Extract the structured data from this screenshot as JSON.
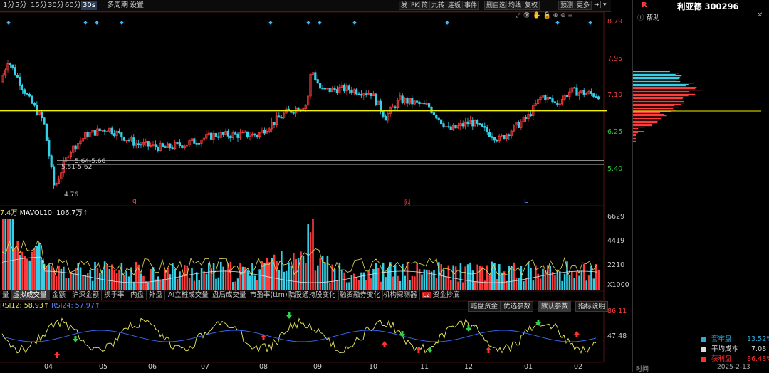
{
  "toolbar": {
    "periods": [
      "1分",
      "5分",
      "15分",
      "30分",
      "60分",
      "30s",
      "多周期",
      "设置"
    ],
    "right_items": [
      "发",
      "PK",
      "简",
      "九转",
      "连板",
      "事件",
      "删自选",
      "均线",
      "复权",
      "预测",
      "更多"
    ]
  },
  "price_axis": {
    "labels": [
      "8.79",
      "7.95",
      "7.10",
      "6.25",
      "5.40"
    ]
  },
  "main_chart": {
    "range_labels": [
      "5.64-5.66",
      "5.51-5.62"
    ],
    "low_label": "4.76",
    "event_markers": [
      "q",
      "财",
      "L"
    ]
  },
  "volume": {
    "header_prefix": "7.4万",
    "ma_label": "MAVOL10: 106.7万↑",
    "axis_labels": [
      "6629",
      "4419",
      "2210",
      "X1000"
    ]
  },
  "indicator_tabs": [
    "量",
    "虚拟成交量",
    "金额",
    "沪深金额",
    "换手率",
    "内盘",
    "外盘",
    "AI立桩成交量",
    "盘后成交量",
    "市盈率(ttm)",
    "陆股通持股变化",
    "融资融券变化",
    "机构探测器",
    "资金抄底"
  ],
  "indicator_buttons": [
    "暗盘资金",
    "优选参数",
    "默认参数",
    "指标说明"
  ],
  "rsi": {
    "rsi12": "RSI12: 58.93↑",
    "rsi24": "RSI24: 57.97↑",
    "axis_top": "86.11",
    "axis_mid": "47.48"
  },
  "x_axis": [
    "04",
    "05",
    "06",
    "07",
    "08",
    "09",
    "10",
    "11",
    "12",
    "01",
    "02"
  ],
  "stock": {
    "code_prefix": "R",
    "title": "利亚德 300296",
    "help": "帮助"
  },
  "chip_stats": {
    "trapped_label": "套牢盘",
    "trapped_value": "13.52%",
    "avg_cost_label": "平均成本",
    "avg_cost_value": "7.08",
    "profit_label": "获利盘",
    "profit_value": "86.48%",
    "date_prefix": "时间",
    "date_value": "2025-2-13"
  },
  "colors": {
    "up": "#ff3b3b",
    "down": "#35d0e8",
    "support_line": "#f2f200",
    "rsi12": "#f0f060",
    "rsi24": "#3a6bff"
  },
  "support_level": 6.75
}
